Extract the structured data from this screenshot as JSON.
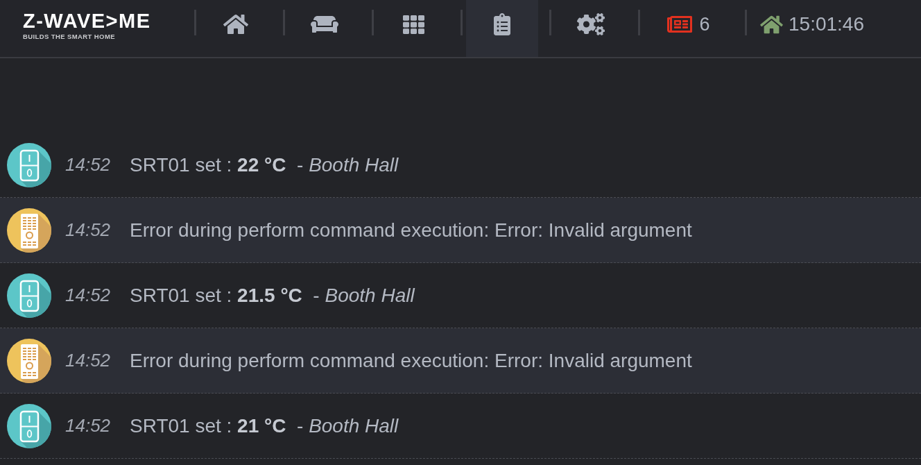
{
  "logo": {
    "name": "Z-WAVE>ME",
    "tagline": "BUILDS THE SMART HOME"
  },
  "nav": [
    {
      "kind": "home",
      "selected": false
    },
    {
      "kind": "rooms",
      "selected": false
    },
    {
      "kind": "elements",
      "selected": false
    },
    {
      "kind": "events",
      "selected": true
    },
    {
      "kind": "settings",
      "selected": false
    }
  ],
  "notifications": {
    "count": "6"
  },
  "clock": {
    "time": "15:01:46"
  },
  "events": [
    {
      "kind": "switch",
      "time": "14:52",
      "message": "SRT01 set : **22 °C**  - *Booth Hall*"
    },
    {
      "kind": "remote",
      "time": "14:52",
      "message": "Error during perform command execution: Error: Invalid argument"
    },
    {
      "kind": "switch",
      "time": "14:52",
      "message": "SRT01 set : **21.5 °C**  - *Booth Hall*"
    },
    {
      "kind": "remote",
      "time": "14:52",
      "message": "Error during perform command execution: Error: Invalid argument"
    },
    {
      "kind": "switch",
      "time": "14:52",
      "message": "SRT01 set : **21 °C**  - *Booth Hall*"
    }
  ]
}
